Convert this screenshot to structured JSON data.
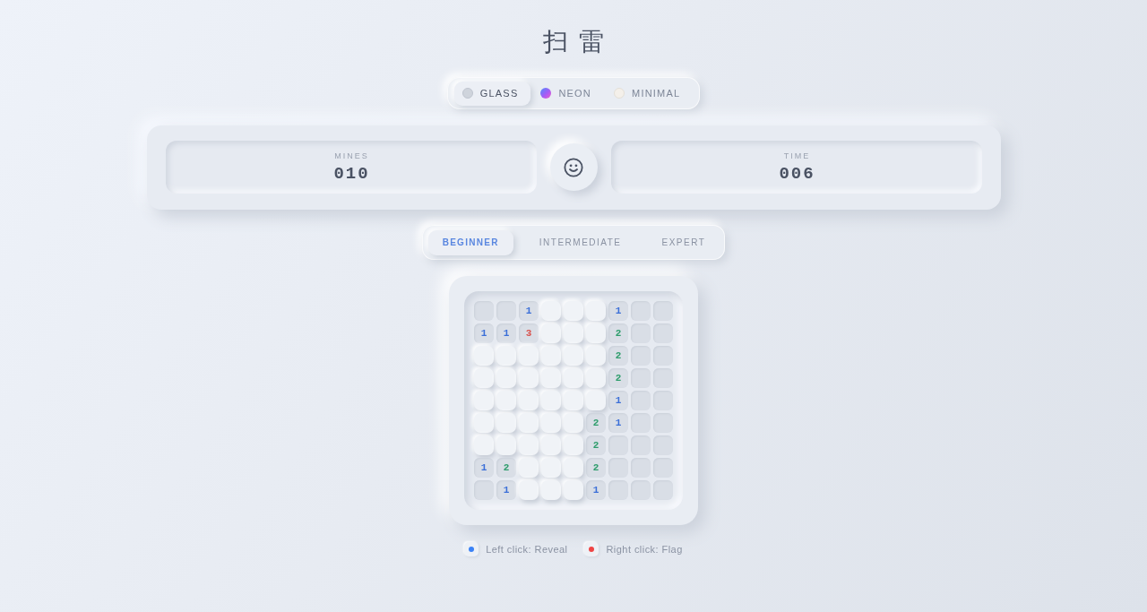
{
  "title": "扫雷",
  "theme_switch": [
    {
      "label": "GLASS",
      "kind": "glass",
      "selected": true
    },
    {
      "label": "NEON",
      "kind": "neon",
      "selected": false
    },
    {
      "label": "MINIMAL",
      "kind": "minimal",
      "selected": false
    }
  ],
  "mines_counter": {
    "label": "MINES",
    "value": "010"
  },
  "time_counter": {
    "label": "TIME",
    "value": "006"
  },
  "difficulty_tabs": [
    {
      "label": "BEGINNER",
      "selected": true
    },
    {
      "label": "INTERMEDIATE",
      "selected": false
    },
    {
      "label": "EXPERT",
      "selected": false
    }
  ],
  "board": {
    "rows": [
      [
        {
          "revealed": true
        },
        {
          "revealed": true
        },
        {
          "revealed": true,
          "value": "1",
          "color": "#3b6fd8"
        },
        {
          "revealed": false
        },
        {
          "revealed": false
        },
        {
          "revealed": false
        },
        {
          "revealed": true,
          "value": "1",
          "color": "#3b6fd8"
        },
        {
          "revealed": true
        },
        {
          "revealed": true
        }
      ],
      [
        {
          "revealed": true,
          "value": "1",
          "color": "#3b6fd8"
        },
        {
          "revealed": true,
          "value": "1",
          "color": "#3b6fd8"
        },
        {
          "revealed": true,
          "value": "3",
          "color": "#d9534f"
        },
        {
          "revealed": false
        },
        {
          "revealed": false
        },
        {
          "revealed": false
        },
        {
          "revealed": true,
          "value": "2",
          "color": "#2e9d6c"
        },
        {
          "revealed": true
        },
        {
          "revealed": true
        }
      ],
      [
        {
          "revealed": false
        },
        {
          "revealed": false
        },
        {
          "revealed": false
        },
        {
          "revealed": false
        },
        {
          "revealed": false
        },
        {
          "revealed": false
        },
        {
          "revealed": true,
          "value": "2",
          "color": "#2e9d6c"
        },
        {
          "revealed": true
        },
        {
          "revealed": true
        }
      ],
      [
        {
          "revealed": false
        },
        {
          "revealed": false
        },
        {
          "revealed": false
        },
        {
          "revealed": false
        },
        {
          "revealed": false
        },
        {
          "revealed": false
        },
        {
          "revealed": true,
          "value": "2",
          "color": "#2e9d6c"
        },
        {
          "revealed": true
        },
        {
          "revealed": true
        }
      ],
      [
        {
          "revealed": false
        },
        {
          "revealed": false
        },
        {
          "revealed": false
        },
        {
          "revealed": false
        },
        {
          "revealed": false
        },
        {
          "revealed": false
        },
        {
          "revealed": true,
          "value": "1",
          "color": "#3b6fd8"
        },
        {
          "revealed": true
        },
        {
          "revealed": true
        }
      ],
      [
        {
          "revealed": false
        },
        {
          "revealed": false
        },
        {
          "revealed": false
        },
        {
          "revealed": false
        },
        {
          "revealed": false
        },
        {
          "revealed": true,
          "value": "2",
          "color": "#2e9d6c"
        },
        {
          "revealed": true,
          "value": "1",
          "color": "#3b6fd8"
        },
        {
          "revealed": true
        },
        {
          "revealed": true
        }
      ],
      [
        {
          "revealed": false
        },
        {
          "revealed": false
        },
        {
          "revealed": false
        },
        {
          "revealed": false
        },
        {
          "revealed": false
        },
        {
          "revealed": true,
          "value": "2",
          "color": "#2e9d6c"
        },
        {
          "revealed": true
        },
        {
          "revealed": true
        },
        {
          "revealed": true
        }
      ],
      [
        {
          "revealed": true,
          "value": "1",
          "color": "#3b6fd8"
        },
        {
          "revealed": true,
          "value": "2",
          "color": "#2e9d6c"
        },
        {
          "revealed": false
        },
        {
          "revealed": false
        },
        {
          "revealed": false
        },
        {
          "revealed": true,
          "value": "2",
          "color": "#2e9d6c"
        },
        {
          "revealed": true
        },
        {
          "revealed": true
        },
        {
          "revealed": true
        }
      ],
      [
        {
          "revealed": true
        },
        {
          "revealed": true,
          "value": "1",
          "color": "#3b6fd8"
        },
        {
          "revealed": false
        },
        {
          "revealed": false
        },
        {
          "revealed": false
        },
        {
          "revealed": true,
          "value": "1",
          "color": "#3b6fd8"
        },
        {
          "revealed": true
        },
        {
          "revealed": true
        },
        {
          "revealed": true
        }
      ]
    ]
  },
  "legend": [
    {
      "text": "Left click: Reveal",
      "color": "#3b82f6"
    },
    {
      "text": "Right click: Flag",
      "color": "#ef4444"
    }
  ]
}
